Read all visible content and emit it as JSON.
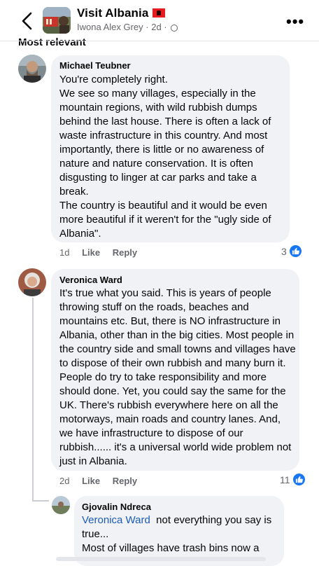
{
  "header": {
    "title": "Visit Albania",
    "author": "Iwona Alex Grey",
    "time": "2d",
    "sort_label": "Most relevant"
  },
  "icons": {
    "back": "chevron-left-icon",
    "more": "more-dots-icon",
    "globe": "globe-icon",
    "like": "thumbs-up-icon",
    "flag": "albania-flag-icon"
  },
  "colors": {
    "accent": "#1877f2",
    "bubble": "#f0f2f5",
    "mention": "#1b5bb9"
  },
  "comments": [
    {
      "name": "Michael Teubner",
      "text": "You're completely right.\nWe see so many villages, especially in the mountain regions, with wild rubbish dumps behind the last house. There is often a lack of waste infrastructure in this country. And most importantly, there is little or no awareness of nature and nature conservation. It is often disgusting to linger at car parks and take a break.\nThe country is beautiful and it would be even more beautiful if it weren't for the \"ugly side of Albania\".",
      "time": "1d",
      "like": "Like",
      "reply": "Reply",
      "reactions": "3"
    },
    {
      "name": "Veronica Ward",
      "text": "It's true what you said. This is years of people throwing stuff on the roads, beaches and mountains etc. But, there is NO infrastructure in Albania, other than in the big cities. Most people in the country side and small towns and villages have to dispose of their own rubbish and many burn it. People do try to take responsibility and more should done. Yet, you could say the same for the UK. There's rubbish everywhere here on all the motorways, main roads and country lanes. And, we have infrastructure to dispose of our rubbish...... it's a universal world wide problem not just in Albania.",
      "time": "2d",
      "like": "Like",
      "reply": "Reply",
      "reactions": "11"
    }
  ],
  "reply": {
    "name": "Gjovalin Ndreca",
    "mention": "Veronica Ward",
    "text": "not everything you say is true...\nMost of villages have trash bins now a"
  }
}
